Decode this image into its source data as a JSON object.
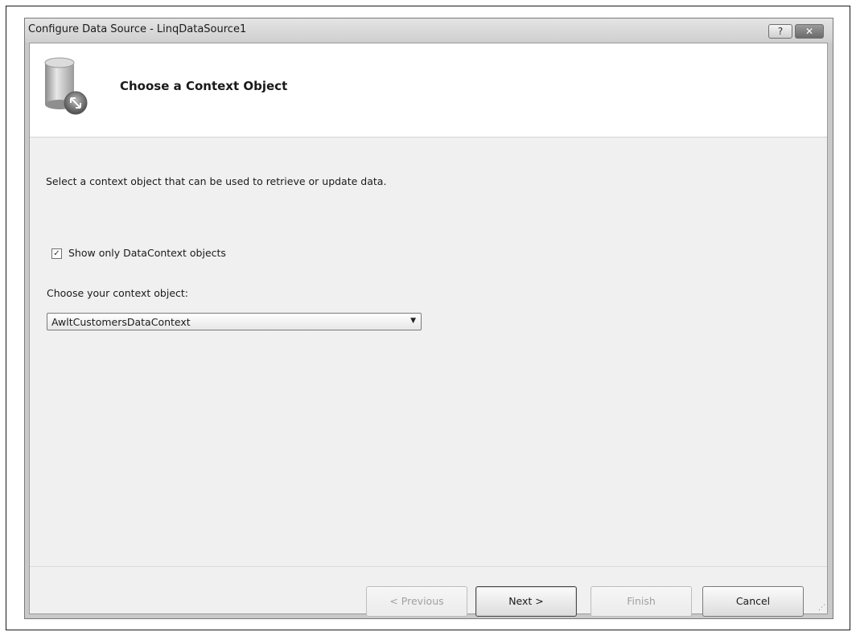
{
  "window": {
    "title": "Configure Data Source - LinqDataSource1",
    "help_label": "?",
    "close_label": "✕"
  },
  "header": {
    "title": "Choose a Context Object",
    "icon": "database-wizard-icon"
  },
  "body": {
    "description": "Select a context object that can be used to retrieve or update data.",
    "show_only_checkbox": {
      "label": "Show only DataContext objects",
      "checked": true
    },
    "context_label": "Choose your context object:",
    "context_select": {
      "value": "AwltCustomersDataContext"
    }
  },
  "buttons": {
    "previous": "< Previous",
    "next": "Next >",
    "finish": "Finish",
    "cancel": "Cancel"
  }
}
